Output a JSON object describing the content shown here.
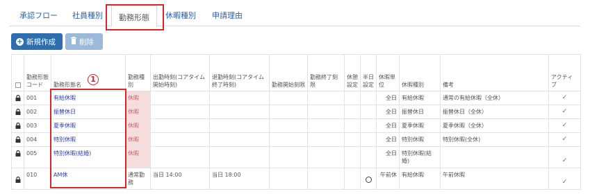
{
  "tabs": [
    {
      "label": "承認フロー"
    },
    {
      "label": "社員種別"
    },
    {
      "label": "勤務形態"
    },
    {
      "label": "休暇種別"
    },
    {
      "label": "申請理由"
    }
  ],
  "toolbar": {
    "new_label": "新規作成",
    "delete_label": "削除"
  },
  "annotation": {
    "badge": "1"
  },
  "table": {
    "headers": {
      "code": "勤務形態コード",
      "name": "勤務形態名",
      "category": "勤務種別",
      "start": "出勤時刻(コアタイム開始時刻)",
      "end": "退勤時刻(コアタイム終了時刻)",
      "work_start": "勤務開始刻限",
      "work_end": "勤務終了刻限",
      "break": "休憩設定",
      "half": "半日設定",
      "unit": "休暇単位",
      "leave_type": "休暇種別",
      "note": "備考",
      "active": "アクティブ"
    },
    "rows": [
      {
        "code": "001",
        "name": "有給休暇",
        "category": "休暇",
        "start": "",
        "end": "",
        "unit": "全日",
        "leave_type": "有給休暇",
        "note": "通常の有給休暇（全休）",
        "active": "✓"
      },
      {
        "code": "002",
        "name": "振替休日",
        "category": "休暇",
        "start": "",
        "end": "",
        "unit": "全日",
        "leave_type": "振替休日",
        "note": "振替休日（全休）",
        "active": "✓"
      },
      {
        "code": "003",
        "name": "夏季休暇",
        "category": "休暇",
        "start": "",
        "end": "",
        "unit": "全日",
        "leave_type": "夏季休暇",
        "note": "夏季休暇（全休）",
        "active": "✓"
      },
      {
        "code": "004",
        "name": "特別休暇",
        "category": "休暇",
        "start": "",
        "end": "",
        "unit": "全日",
        "leave_type": "特別休暇",
        "note": "特別休暇(全休)",
        "active": "✓"
      },
      {
        "code": "005",
        "name": "特別休暇(結婚)",
        "category": "休暇",
        "start": "",
        "end": "",
        "unit": "全日",
        "leave_type": "特別休暇(結婚)",
        "note": "",
        "active": "✓"
      },
      {
        "code": "010",
        "name": "AM休",
        "category": "通常勤務",
        "start": "当日 14:00",
        "end": "当日 18:00",
        "half": "○",
        "unit": "午前休",
        "leave_type": "有給休暇",
        "note": "午前休暇",
        "active": "✓"
      }
    ]
  }
}
